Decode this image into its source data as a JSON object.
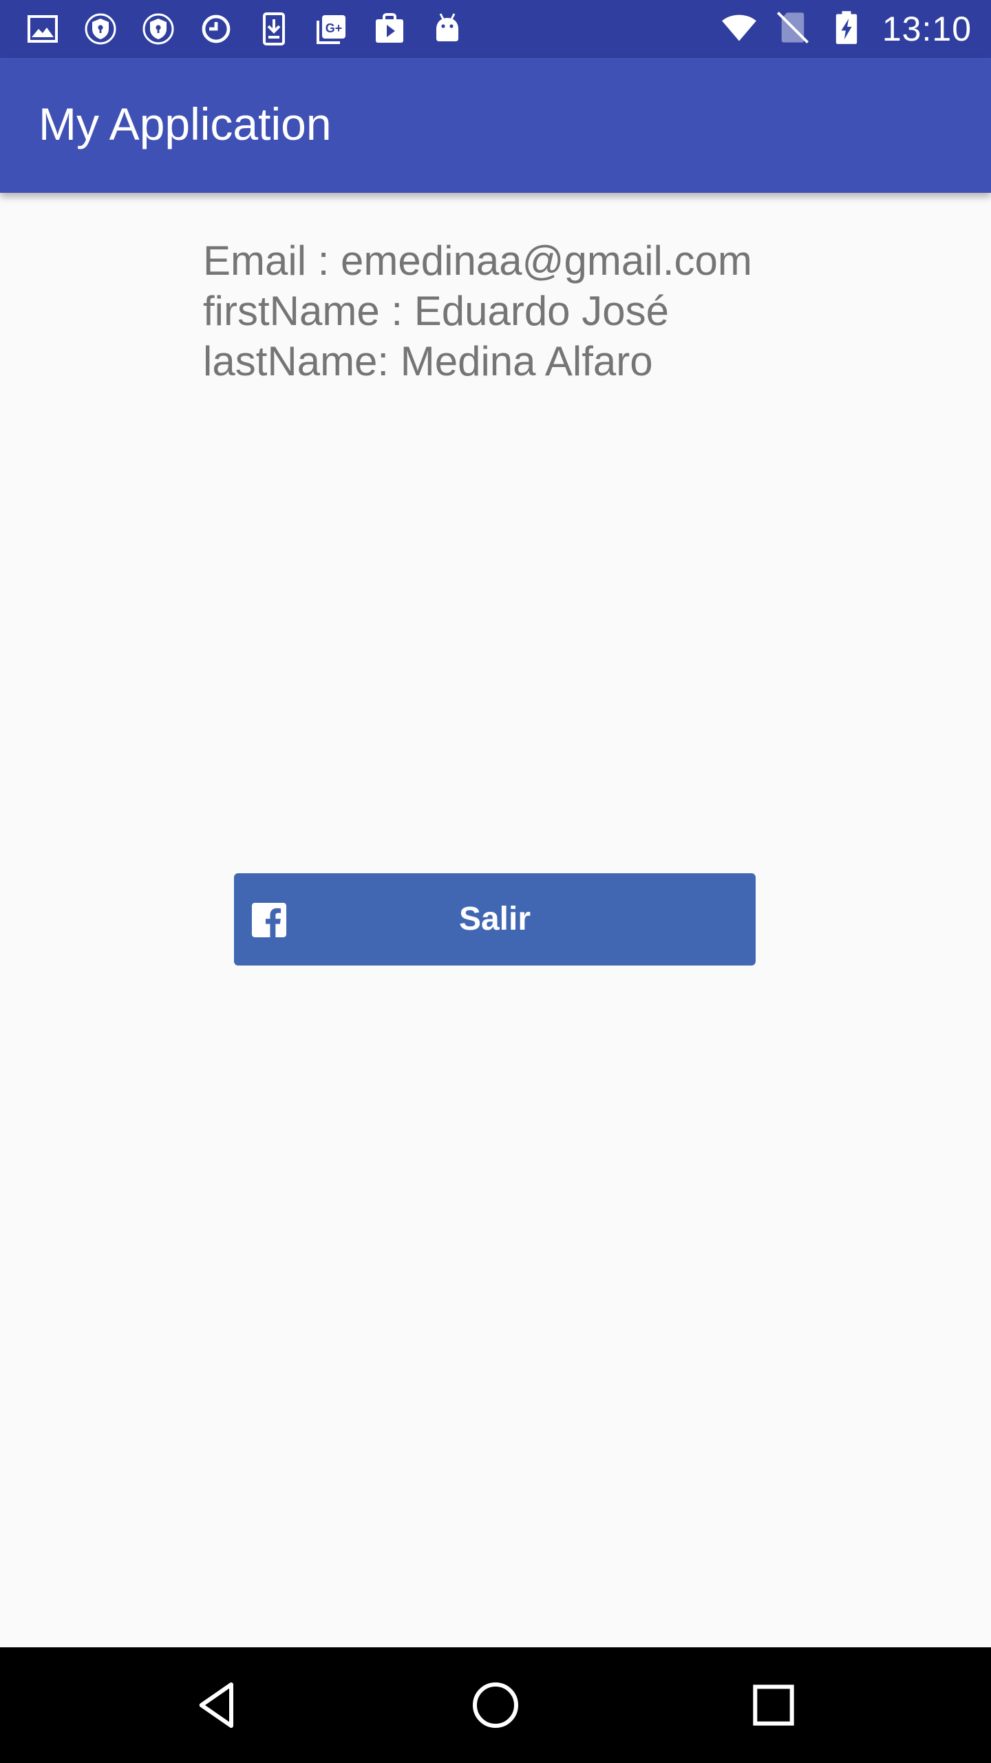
{
  "status_bar": {
    "time": "13:10",
    "left_icons": [
      "image-icon",
      "vpn-shield-icon",
      "vpn-shield-icon",
      "alarm-clock-icon",
      "download-icon",
      "google-plus-icon",
      "play-store-icon",
      "android-icon"
    ],
    "right_icons": [
      "wifi-icon",
      "no-sim-icon",
      "battery-charging-icon"
    ]
  },
  "app_bar": {
    "title": "My Application"
  },
  "profile": {
    "email_line": "Email : emedinaa@gmail.com",
    "first_name_line": "firstName : Eduardo José",
    "last_name_line": "lastName: Medina Alfaro"
  },
  "logout_button": {
    "label": "Salir",
    "icon": "facebook-icon"
  },
  "nav_bar": {
    "buttons": [
      "back-icon",
      "home-icon",
      "recents-icon"
    ]
  },
  "colors": {
    "status_bar": "#303f9f",
    "app_bar": "#3f51b5",
    "facebook_button": "#4267b2",
    "body_text": "#757575",
    "background": "#fafafa"
  }
}
